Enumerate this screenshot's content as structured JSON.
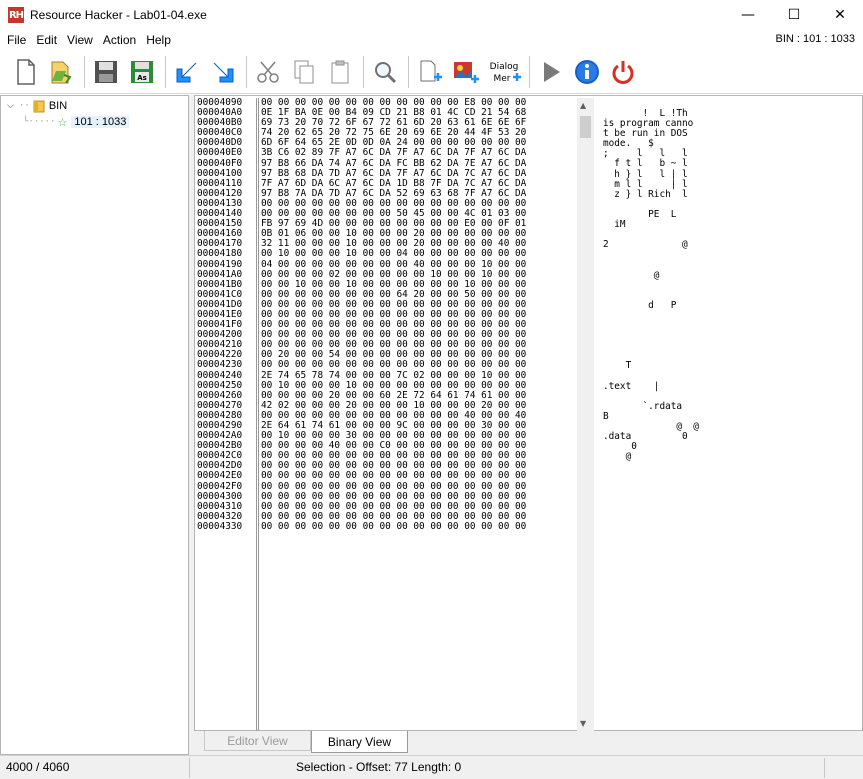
{
  "window": {
    "title": "Resource Hacker - Lab01-04.exe",
    "app_icon_text": "RH",
    "minimize": "—",
    "maximize": "☐",
    "close": "✕"
  },
  "menu": {
    "items": [
      "File",
      "Edit",
      "View",
      "Action",
      "Help"
    ],
    "resource_info": "BIN : 101 : 1033"
  },
  "toolbar": {
    "buttons": [
      "new",
      "open",
      "save",
      "save-as",
      "import",
      "export",
      "cut",
      "copy",
      "paste",
      "find",
      "add-resource",
      "replace-resource",
      "dialog-menu",
      "run",
      "info",
      "exit"
    ],
    "dialog_menu_label_top": "Dialog",
    "dialog_menu_label_bottom": "Mer"
  },
  "tree": {
    "root_label": "BIN",
    "child_label": "101 : 1033"
  },
  "hex": {
    "addresses": [
      "00004090",
      "000040A0",
      "000040B0",
      "000040C0",
      "000040D0",
      "000040E0",
      "000040F0",
      "00004100",
      "00004110",
      "00004120",
      "00004130",
      "00004140",
      "00004150",
      "00004160",
      "00004170",
      "00004180",
      "00004190",
      "000041A0",
      "000041B0",
      "000041C0",
      "000041D0",
      "000041E0",
      "000041F0",
      "00004200",
      "00004210",
      "00004220",
      "00004230",
      "00004240",
      "00004250",
      "00004260",
      "00004270",
      "00004280",
      "00004290",
      "000042A0",
      "000042B0",
      "000042C0",
      "000042D0",
      "000042E0",
      "000042F0",
      "00004300",
      "00004310",
      "00004320",
      "00004330"
    ],
    "bytes": [
      "00 00 00 00 00 00 00 00 00 00 00 00 E8 00 00 00",
      "0E 1F BA 0E 00 B4 09 CD 21 B8 01 4C CD 21 54 68",
      "69 73 20 70 72 6F 67 72 61 6D 20 63 61 6E 6E 6F",
      "74 20 62 65 20 72 75 6E 20 69 6E 20 44 4F 53 20",
      "6D 6F 64 65 2E 0D 0D 0A 24 00 00 00 00 00 00 00",
      "3B C6 02 89 7F A7 6C DA 7F A7 6C DA 7F A7 6C DA",
      "97 B8 66 DA 74 A7 6C DA FC BB 62 DA 7E A7 6C DA",
      "97 B8 68 DA 7D A7 6C DA 7F A7 6C DA 7C A7 6C DA",
      "7F A7 6D DA 6C A7 6C DA 1D B8 7F DA 7C A7 6C DA",
      "97 B8 7A DA 7D A7 6C DA 52 69 63 68 7F A7 6C DA",
      "00 00 00 00 00 00 00 00 00 00 00 00 00 00 00 00",
      "00 00 00 00 00 00 00 00 50 45 00 00 4C 01 03 00",
      "FB 97 69 4D 00 00 00 00 00 00 00 00 E0 00 0F 01",
      "0B 01 06 00 00 10 00 00 00 20 00 00 00 00 00 00",
      "32 11 00 00 00 10 00 00 00 20 00 00 00 00 40 00",
      "00 10 00 00 00 10 00 00 04 00 00 00 00 00 00 00",
      "04 00 00 00 00 00 00 00 00 40 00 00 00 10 00 00",
      "00 00 00 00 02 00 00 00 00 00 10 00 00 10 00 00",
      "00 00 10 00 00 10 00 00 00 00 00 00 10 00 00 00",
      "00 00 00 00 00 00 00 00 64 20 00 00 50 00 00 00",
      "00 00 00 00 00 00 00 00 00 00 00 00 00 00 00 00",
      "00 00 00 00 00 00 00 00 00 00 00 00 00 00 00 00",
      "00 00 00 00 00 00 00 00 00 00 00 00 00 00 00 00",
      "00 00 00 00 00 00 00 00 00 00 00 00 00 00 00 00",
      "00 00 00 00 00 00 00 00 00 00 00 00 00 00 00 00",
      "00 20 00 00 54 00 00 00 00 00 00 00 00 00 00 00",
      "00 00 00 00 00 00 00 00 00 00 00 00 00 00 00 00",
      "2E 74 65 78 74 00 00 00 7C 02 00 00 00 10 00 00",
      "00 10 00 00 00 10 00 00 00 00 00 00 00 00 00 00",
      "00 00 00 00 20 00 00 60 2E 72 64 61 74 61 00 00",
      "42 02 00 00 00 20 00 00 00 10 00 00 00 20 00 00",
      "00 00 00 00 00 00 00 00 00 00 00 00 40 00 00 40",
      "2E 64 61 74 61 00 00 00 9C 00 00 00 00 30 00 00",
      "00 10 00 00 00 30 00 00 00 00 00 00 00 00 00 00",
      "00 00 00 00 40 00 00 C0 00 00 00 00 00 00 00 00",
      "00 00 00 00 00 00 00 00 00 00 00 00 00 00 00 00",
      "00 00 00 00 00 00 00 00 00 00 00 00 00 00 00 00",
      "00 00 00 00 00 00 00 00 00 00 00 00 00 00 00 00",
      "00 00 00 00 00 00 00 00 00 00 00 00 00 00 00 00",
      "00 00 00 00 00 00 00 00 00 00 00 00 00 00 00 00",
      "00 00 00 00 00 00 00 00 00 00 00 00 00 00 00 00",
      "00 00 00 00 00 00 00 00 00 00 00 00 00 00 00 00",
      "00 00 00 00 00 00 00 00 00 00 00 00 00 00 00 00"
    ],
    "ascii": [
      "       !  L !Th",
      "is program canno",
      "t be run in DOS",
      "mode.   $",
      ";     l   l   l",
      "  f t l   b ~ l",
      "  h } l   l | l",
      "  m l l     | l",
      "  z } l Rich  l",
      "",
      "        PE  L",
      "  iM",
      "",
      "2             @",
      "",
      "",
      "         @",
      "",
      "",
      "        d   P",
      "",
      "",
      "",
      "",
      "",
      "    T",
      "",
      ".text    |",
      "",
      "       `.rdata",
      "B",
      "             @  @",
      ".data         0",
      "     0",
      "    @"
    ]
  },
  "tabs": {
    "editor_view": "Editor View",
    "binary_view": "Binary View"
  },
  "status": {
    "left": "4000 / 4060",
    "middle": "Selection - Offset: 77 Length: 0"
  }
}
